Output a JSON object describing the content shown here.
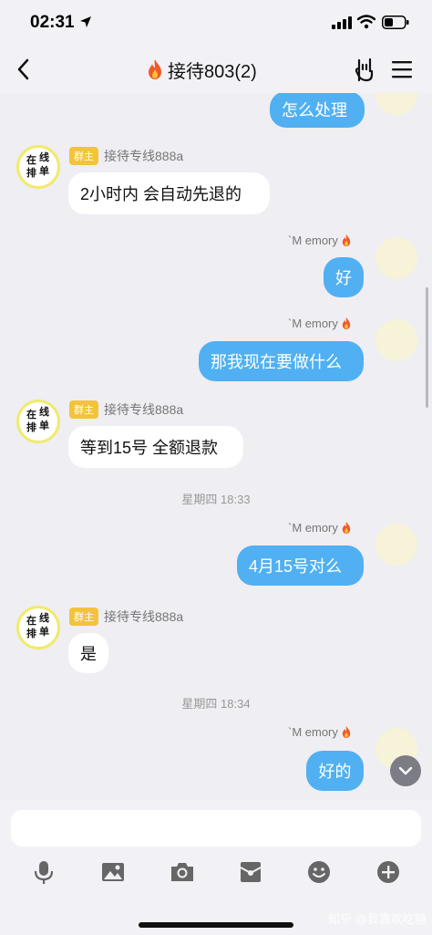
{
  "status_bar": {
    "time": "02:31"
  },
  "header": {
    "title": "接待803(2)"
  },
  "messages": [
    {
      "type": "out",
      "sender": "",
      "text": "怎么处理"
    },
    {
      "type": "in",
      "badge": "群主",
      "sender": "接待专线888a",
      "text": "2小时内 会自动先退的"
    },
    {
      "type": "out",
      "sender": "`M emory",
      "text": "好"
    },
    {
      "type": "out",
      "sender": "`M emory",
      "text": "那我现在要做什么"
    },
    {
      "type": "in",
      "badge": "群主",
      "sender": "接待专线888a",
      "text": "等到15号 全额退款"
    },
    {
      "type": "time",
      "text": "星期四 18:33"
    },
    {
      "type": "out",
      "sender": "`M emory",
      "text": "4月15号对么"
    },
    {
      "type": "in",
      "badge": "群主",
      "sender": "接待专线888a",
      "text": "是"
    },
    {
      "type": "time",
      "text": "星期四 18:34"
    },
    {
      "type": "out",
      "sender": "`M emory",
      "text": "好的"
    }
  ],
  "avatar_in_text": [
    "在",
    "线",
    "排",
    "单"
  ],
  "input": {
    "value": "",
    "placeholder": ""
  },
  "toolbar": [
    "microphone-icon",
    "image-icon",
    "camera-icon",
    "red-packet-icon",
    "emoji-icon",
    "plus-icon"
  ],
  "watermark": "知乎 @我喜欢吃糖",
  "colors": {
    "out_bubble": "#50b0f2",
    "in_bubble": "#ffffff",
    "background": "#eeeef3",
    "badge": "#f3c33b"
  }
}
